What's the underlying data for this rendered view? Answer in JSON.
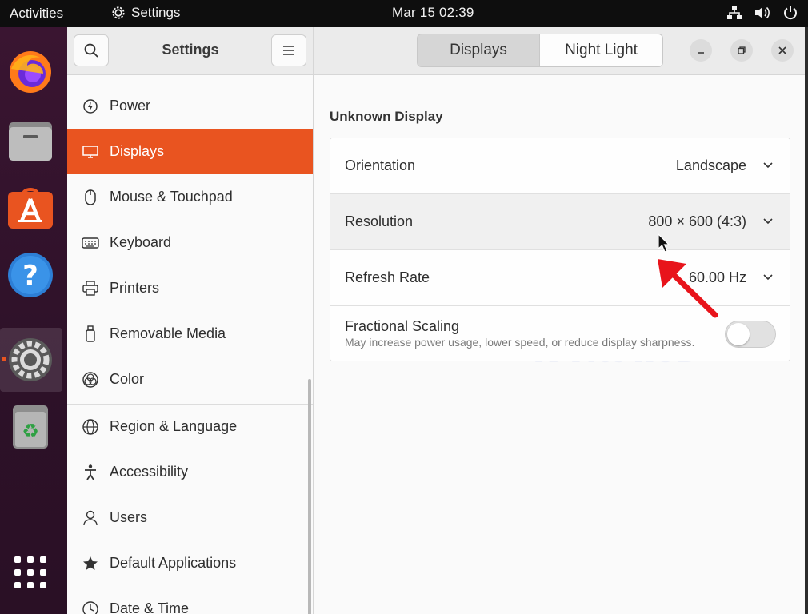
{
  "topbar": {
    "activities": "Activities",
    "app_name": "Settings",
    "clock": "Mar 15  02:39"
  },
  "dock": {
    "items": [
      "firefox-icon",
      "files-icon",
      "app-center-icon",
      "help-icon",
      "settings-icon",
      "trash-icon",
      "show-apps-icon"
    ]
  },
  "sidebar": {
    "title": "Settings",
    "items": [
      {
        "label": "Power",
        "icon": "power-icon"
      },
      {
        "label": "Displays",
        "icon": "display-icon"
      },
      {
        "label": "Mouse & Touchpad",
        "icon": "mouse-icon"
      },
      {
        "label": "Keyboard",
        "icon": "keyboard-icon"
      },
      {
        "label": "Printers",
        "icon": "printer-icon"
      },
      {
        "label": "Removable Media",
        "icon": "usb-icon"
      },
      {
        "label": "Color",
        "icon": "color-icon"
      },
      {
        "label": "Region & Language",
        "icon": "globe-icon"
      },
      {
        "label": "Accessibility",
        "icon": "accessibility-icon"
      },
      {
        "label": "Users",
        "icon": "users-icon"
      },
      {
        "label": "Default Applications",
        "icon": "star-icon"
      },
      {
        "label": "Date & Time",
        "icon": "clock-icon"
      }
    ]
  },
  "header": {
    "tabs": [
      "Displays",
      "Night Light"
    ]
  },
  "main": {
    "section_title": "Unknown Display",
    "rows": {
      "orientation": {
        "label": "Orientation",
        "value": "Landscape"
      },
      "resolution": {
        "label": "Resolution",
        "value": "800 × 600 (4:3)"
      },
      "refresh": {
        "label": "Refresh Rate",
        "value": "60.00 Hz"
      },
      "scaling": {
        "label": "Fractional Scaling",
        "subtitle": "May increase power usage, lower speed, or reduce display sharpness."
      }
    }
  },
  "watermark": "IT Pros HUB",
  "colors": {
    "accent": "#e95420",
    "topbar": "#0e0e0e",
    "dock": "#2d1128",
    "annotation_arrow": "#e8141b"
  }
}
